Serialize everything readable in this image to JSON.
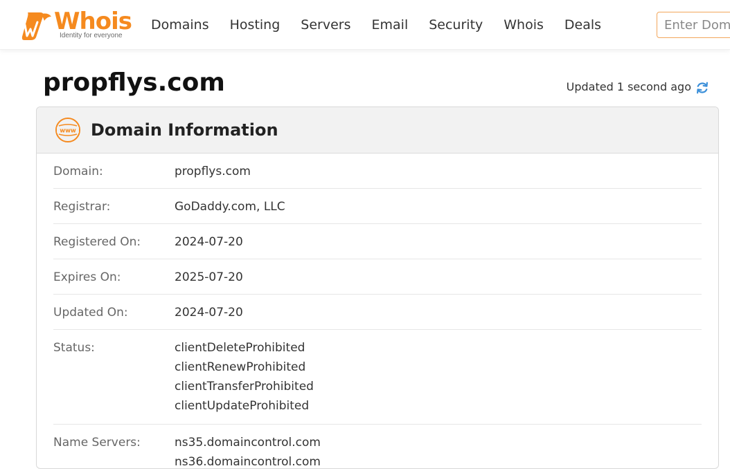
{
  "brand": {
    "name": "Whois",
    "tagline": "Identity for everyone",
    "primary_color": "#f58a1f"
  },
  "nav": {
    "items": [
      "Domains",
      "Hosting",
      "Servers",
      "Email",
      "Security",
      "Whois",
      "Deals"
    ]
  },
  "search": {
    "placeholder": "Enter Domain or IP"
  },
  "page": {
    "domain": "propflys.com",
    "updated_text": "Updated 1 second ago",
    "refresh_icon": "refresh-icon"
  },
  "card": {
    "title": "Domain Information",
    "icon": "www-icon",
    "rows": [
      {
        "label": "Domain:",
        "values": [
          "propflys.com"
        ]
      },
      {
        "label": "Registrar:",
        "values": [
          "GoDaddy.com, LLC"
        ]
      },
      {
        "label": "Registered On:",
        "values": [
          "2024-07-20"
        ]
      },
      {
        "label": "Expires On:",
        "values": [
          "2025-07-20"
        ]
      },
      {
        "label": "Updated On:",
        "values": [
          "2024-07-20"
        ]
      },
      {
        "label": "Status:",
        "values": [
          "clientDeleteProhibited",
          "clientRenewProhibited",
          "clientTransferProhibited",
          "clientUpdateProhibited"
        ]
      },
      {
        "label": "Name Servers:",
        "values": [
          "ns35.domaincontrol.com",
          "ns36.domaincontrol.com"
        ]
      }
    ]
  }
}
